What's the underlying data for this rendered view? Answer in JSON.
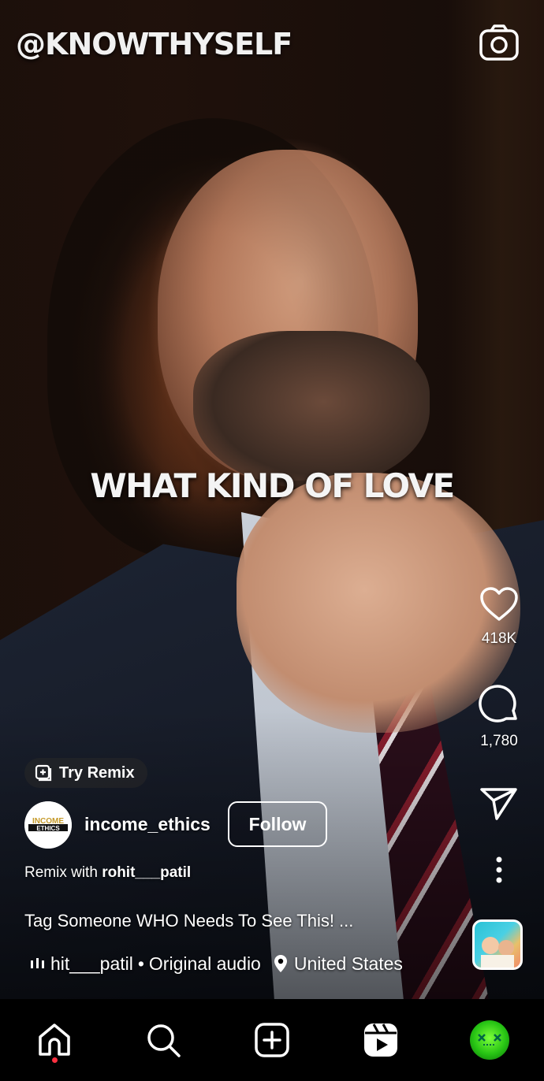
{
  "video": {
    "watermark": "@KNOWTHYSELF",
    "caption": "WHAT KIND OF LOVE"
  },
  "actions": {
    "likes": "418K",
    "comments": "1,780"
  },
  "post": {
    "remix_chip_label": "Try Remix",
    "avatar_text_top": "INCOME",
    "avatar_text_bottom": "ETHICS",
    "username": "income_ethics",
    "follow_label": "Follow",
    "remix_prefix": "Remix with ",
    "remix_user": "rohit___patil",
    "description": "Tag Someone WHO Needs To See This! ...",
    "audio_user": "hit___patil",
    "audio_separator": "•",
    "audio_label": "Original audio",
    "location": "United States"
  },
  "icons": {
    "camera": "camera-icon",
    "like": "heart-icon",
    "comment": "comment-icon",
    "share": "send-icon",
    "more": "more-vertical-icon",
    "audio": "audio-bars-icon",
    "location": "location-pin-icon",
    "home": "home-icon",
    "search": "search-icon",
    "create": "plus-square-icon",
    "reels": "reels-icon"
  },
  "colors": {
    "background": "#000000",
    "text": "#ffffff",
    "notification_dot": "#ff3040"
  }
}
